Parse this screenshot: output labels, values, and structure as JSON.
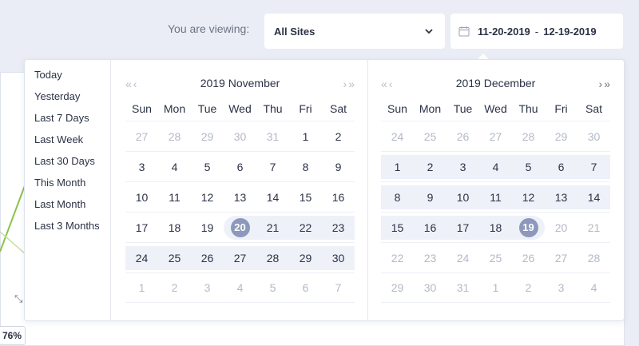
{
  "toolbar": {
    "viewing_label": "You are viewing:",
    "site_select_value": "All Sites",
    "date_start": "11-20-2019",
    "date_separator": "-",
    "date_end": "12-19-2019"
  },
  "background": {
    "percent_badge": "76%"
  },
  "presets": [
    "Today",
    "Yesterday",
    "Last 7 Days",
    "Last Week",
    "Last 30 Days",
    "This Month",
    "Last Month",
    "Last 3 Months"
  ],
  "weekdays": [
    "Sun",
    "Mon",
    "Tue",
    "Wed",
    "Thu",
    "Fri",
    "Sat"
  ],
  "months": [
    {
      "title": "2019 November",
      "nav_prev": [
        "«",
        "‹"
      ],
      "nav_next": [
        "›",
        "»"
      ],
      "weeks": [
        [
          "27",
          "28",
          "29",
          "30",
          "31",
          "1",
          "2"
        ],
        [
          "3",
          "4",
          "5",
          "6",
          "7",
          "8",
          "9"
        ],
        [
          "10",
          "11",
          "12",
          "13",
          "14",
          "15",
          "16"
        ],
        [
          "17",
          "18",
          "19",
          "20",
          "21",
          "22",
          "23"
        ],
        [
          "24",
          "25",
          "26",
          "27",
          "28",
          "29",
          "30"
        ],
        [
          "1",
          "2",
          "3",
          "4",
          "5",
          "6",
          "7"
        ]
      ]
    },
    {
      "title": "2019 December",
      "nav_prev": [
        "«",
        "‹"
      ],
      "nav_next": [
        "›",
        "»"
      ],
      "weeks": [
        [
          "24",
          "25",
          "26",
          "27",
          "28",
          "29",
          "30"
        ],
        [
          "1",
          "2",
          "3",
          "4",
          "5",
          "6",
          "7"
        ],
        [
          "8",
          "9",
          "10",
          "11",
          "12",
          "13",
          "14"
        ],
        [
          "15",
          "16",
          "17",
          "18",
          "19",
          "20",
          "21"
        ],
        [
          "22",
          "23",
          "24",
          "25",
          "26",
          "27",
          "28"
        ],
        [
          "29",
          "30",
          "31",
          "1",
          "2",
          "3",
          "4"
        ]
      ]
    }
  ],
  "colors": {
    "range_fill": "#eef1f8",
    "endpoint": "#8d98bb",
    "muted_day": "#b3b9c6",
    "page_bg": "#eaedf5"
  }
}
